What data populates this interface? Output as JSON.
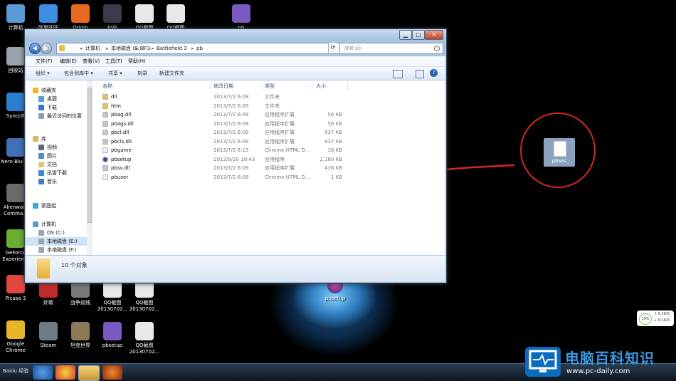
{
  "desktop": {
    "left_icons": [
      {
        "label": "计算机",
        "color": "#5b9bd5"
      },
      {
        "label": "回收站",
        "color": "#9aa4ad"
      },
      {
        "label": "SyncUP",
        "color": "#2a7fd0"
      },
      {
        "label": "Nero Blu-r...",
        "color": "#3f6fb8"
      },
      {
        "label": "Alienware Comma...",
        "color": "#6a6a6a"
      },
      {
        "label": "GeForce Experien...",
        "color": "#6aae2f"
      },
      {
        "label": "Picasa 3",
        "color": "#e0483b"
      },
      {
        "label": "Google Chrome",
        "color": "#e8b52b"
      }
    ],
    "top_icons": [
      {
        "label": "阿里旺旺",
        "color": "#3b8ee0"
      },
      {
        "label": "Origin",
        "color": "#e86a1f"
      },
      {
        "label": "EVE",
        "color": "#3a3a48"
      },
      {
        "label": "QQ截图",
        "color": "#e8e8e8"
      },
      {
        "label": "QQ截图",
        "color": "#e8e8e8"
      },
      {
        "label": "pb",
        "color": "#7a5ac0"
      }
    ],
    "bottom_icons": [
      {
        "label": "虾歌",
        "color": "#c02a2a"
      },
      {
        "label": "战争前线",
        "color": "#7a7a7a"
      },
      {
        "label": "QQ截图 20130702...",
        "color": "#e8e8e8"
      },
      {
        "label": "QQ截图 20130702...",
        "color": "#e8e8e8"
      },
      {
        "label": "Steam",
        "color": "#6d7a88"
      },
      {
        "label": "坦克世界",
        "color": "#8a7a55"
      },
      {
        "label": "pbsetup",
        "color": "#7a5ac0"
      },
      {
        "label": "QQ截图 20130702...",
        "color": "#e8e8e8"
      }
    ],
    "center_icon_label": "pbsetup",
    "highlighted_file_label": "pbsec",
    "annotation_color": "#d8261f"
  },
  "window": {
    "controls": {
      "minimize": "▁",
      "maximize": "□",
      "close": "✕"
    },
    "breadcrumb": [
      "计算机",
      "本地磁盘 (E:)",
      "BF3",
      "Battlefield 3",
      "pb"
    ],
    "search_placeholder": "搜索 pb",
    "menu": [
      "文件(F)",
      "编辑(E)",
      "查看(V)",
      "工具(T)",
      "帮助(H)"
    ],
    "commands": [
      "组织 ▾",
      "包含到库中 ▾",
      "共享 ▾",
      "刻录",
      "新建文件夹"
    ],
    "nav_items": [
      {
        "label": "收藏夹",
        "color": "#e8b52b"
      },
      {
        "label": "桌面",
        "color": "#5b9bd5"
      },
      {
        "label": "下载",
        "color": "#3a76c0"
      },
      {
        "label": "最近访问的位置",
        "color": "#8aa0b8"
      },
      {
        "label": "库",
        "color": "#d9b86a"
      },
      {
        "label": "视频",
        "color": "#5a6b7e"
      },
      {
        "label": "图片",
        "color": "#4c8cc8"
      },
      {
        "label": "文档",
        "color": "#e2c87a"
      },
      {
        "label": "迅雷下载",
        "color": "#3a86d8"
      },
      {
        "label": "音乐",
        "color": "#4a7ab8"
      },
      {
        "label": "家庭组",
        "color": "#4aa0d8"
      },
      {
        "label": "计算机",
        "color": "#5b9bd5"
      },
      {
        "label": "OS (C:)",
        "color": "#9aa4ad"
      },
      {
        "label": "本地磁盘 (E:)",
        "color": "#9aa4ad"
      },
      {
        "label": "本地磁盘 (F:)",
        "color": "#9aa4ad"
      }
    ],
    "columns": {
      "name": "名称",
      "date": "修改日期",
      "type": "类型",
      "size": "大小"
    },
    "files": [
      {
        "name": "dll",
        "date": "2013/7/2 6:09",
        "type": "文件夹",
        "size": "",
        "icon": "#e8c24a"
      },
      {
        "name": "htm",
        "date": "2013/7/2 6:09",
        "type": "文件夹",
        "size": "",
        "icon": "#e8c24a"
      },
      {
        "name": "pbag.dll",
        "date": "2013/7/2 6:09",
        "type": "应用程序扩展",
        "size": "56 KB",
        "icon": "#bfc6cf"
      },
      {
        "name": "pbags.dll",
        "date": "2013/7/2 6:09",
        "type": "应用程序扩展",
        "size": "56 KB",
        "icon": "#bfc6cf"
      },
      {
        "name": "pbcl.dll",
        "date": "2013/7/2 6:09",
        "type": "应用程序扩展",
        "size": "937 KB",
        "icon": "#bfc6cf"
      },
      {
        "name": "pbcls.dll",
        "date": "2013/7/2 6:09",
        "type": "应用程序扩展",
        "size": "937 KB",
        "icon": "#bfc6cf"
      },
      {
        "name": "pbgame",
        "date": "2013/7/2 6:15",
        "type": "Chrome HTML D...",
        "size": "16 KB",
        "icon": "#eef0f3"
      },
      {
        "name": "pbsetup",
        "date": "2012/9/20 19:43",
        "type": "应用程序",
        "size": "2,160 KB",
        "icon": "#5a3aa0"
      },
      {
        "name": "pbsv.dll",
        "date": "2013/7/2 6:09",
        "type": "应用程序扩展",
        "size": "416 KB",
        "icon": "#bfc6cf"
      },
      {
        "name": "pbuser",
        "date": "2013/7/2 6:08",
        "type": "Chrome HTML D...",
        "size": "1 KB",
        "icon": "#eef0f3"
      }
    ],
    "status": "10 个对象"
  },
  "tray_widget": {
    "percent": "19%",
    "up": "↑ 0.2K/S",
    "down": "↓ 0.1K/S"
  },
  "taskbar": {
    "start_text": "Baidu 经验"
  },
  "brand": {
    "title": "电脑百科知识",
    "url": "www.pc-daily.com"
  }
}
